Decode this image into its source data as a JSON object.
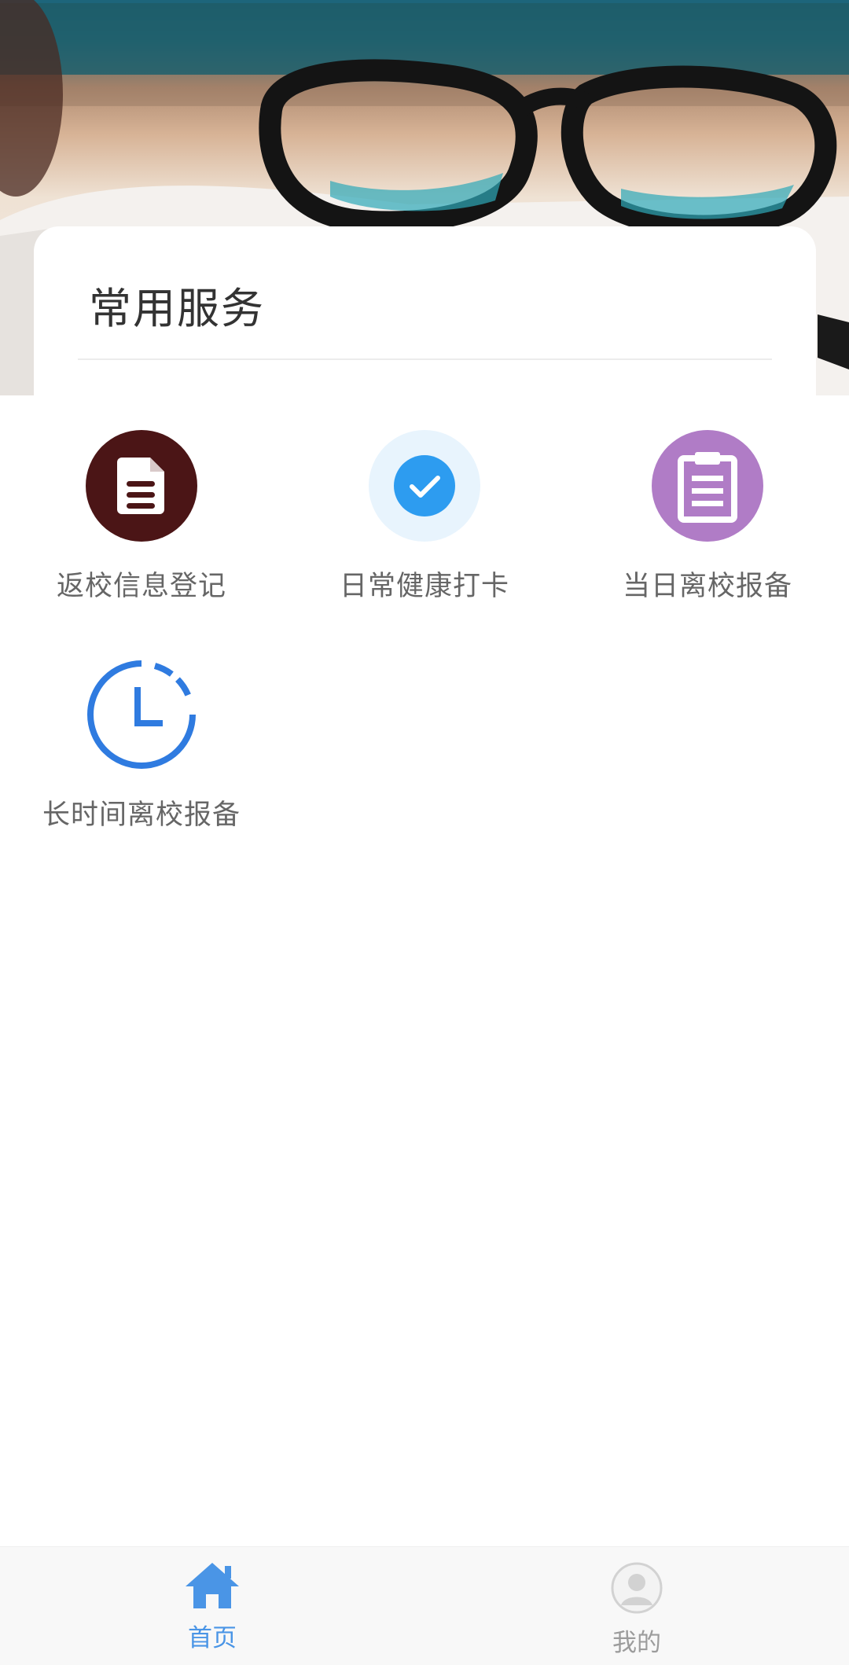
{
  "header": {
    "section_title": "常用服务"
  },
  "services": [
    {
      "label": "返校信息登记",
      "icon": "document-icon",
      "color": "#4b1516"
    },
    {
      "label": "日常健康打卡",
      "icon": "check-icon",
      "color": "#2d9cf0"
    },
    {
      "label": "当日离校报备",
      "icon": "clipboard-icon",
      "color": "#b07cc6"
    },
    {
      "label": "长时间离校报备",
      "icon": "clock-icon",
      "color": "#2f7be0"
    }
  ],
  "tabbar": {
    "home_label": "首页",
    "me_label": "我的",
    "active_color": "#4a95e6",
    "inactive_color": "#9c9c9c"
  }
}
